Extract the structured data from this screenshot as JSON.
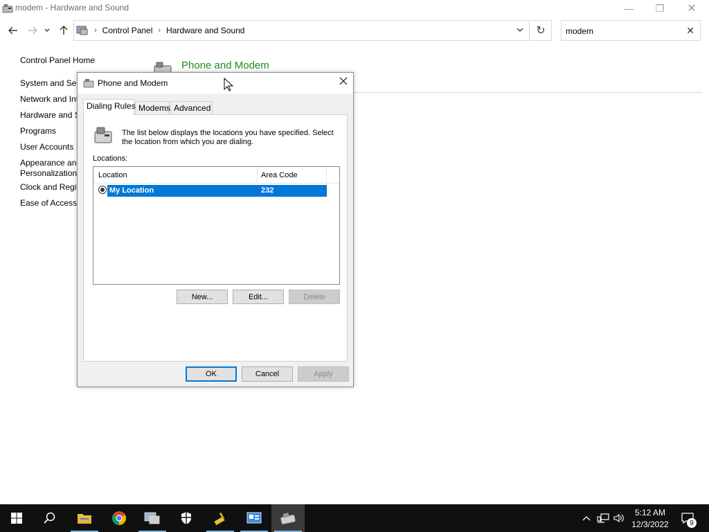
{
  "window": {
    "title": "modem - Hardware and Sound",
    "minimize": "—",
    "restore": "❐",
    "close": "✕"
  },
  "address_bar": {
    "crumbs": [
      "Control Panel",
      "Hardware and Sound"
    ],
    "search_value": "modem"
  },
  "left_nav": {
    "items": [
      "Control Panel Home",
      "System and Sec",
      "Network and Int",
      "Hardware and S",
      "Programs",
      "User Accounts",
      "Appearance and",
      "Personalization",
      "Clock and Regio",
      "Ease of Access"
    ]
  },
  "main": {
    "heading": "Phone and Modem",
    "heading_color": "#1e8a1e"
  },
  "dialog": {
    "title": "Phone and Modem",
    "tabs": [
      "Dialing Rules",
      "Modems",
      "Advanced"
    ],
    "active_tab": "Dialing Rules",
    "description": "The list below displays the locations you have specified. Select the location from which you are dialing.",
    "locations_label": "Locations:",
    "columns": [
      "Location",
      "Area Code"
    ],
    "rows": [
      {
        "location": "My Location",
        "area_code": "232",
        "selected": true
      }
    ],
    "buttons": {
      "new": "New...",
      "edit": "Edit...",
      "delete": "Delete",
      "ok": "OK",
      "cancel": "Cancel",
      "apply": "Apply"
    },
    "selection_color": "#0078d7"
  },
  "taskbar": {
    "pinned": [
      "start-icon",
      "search-icon",
      "file-explorer-icon",
      "chrome-icon",
      "control-panel-icon",
      "windows-security-icon",
      "cleanup-icon",
      "system-info-icon",
      "phone-modem-icon"
    ],
    "time": "5:12 AM",
    "date": "12/3/2022",
    "notification_count": "9"
  }
}
